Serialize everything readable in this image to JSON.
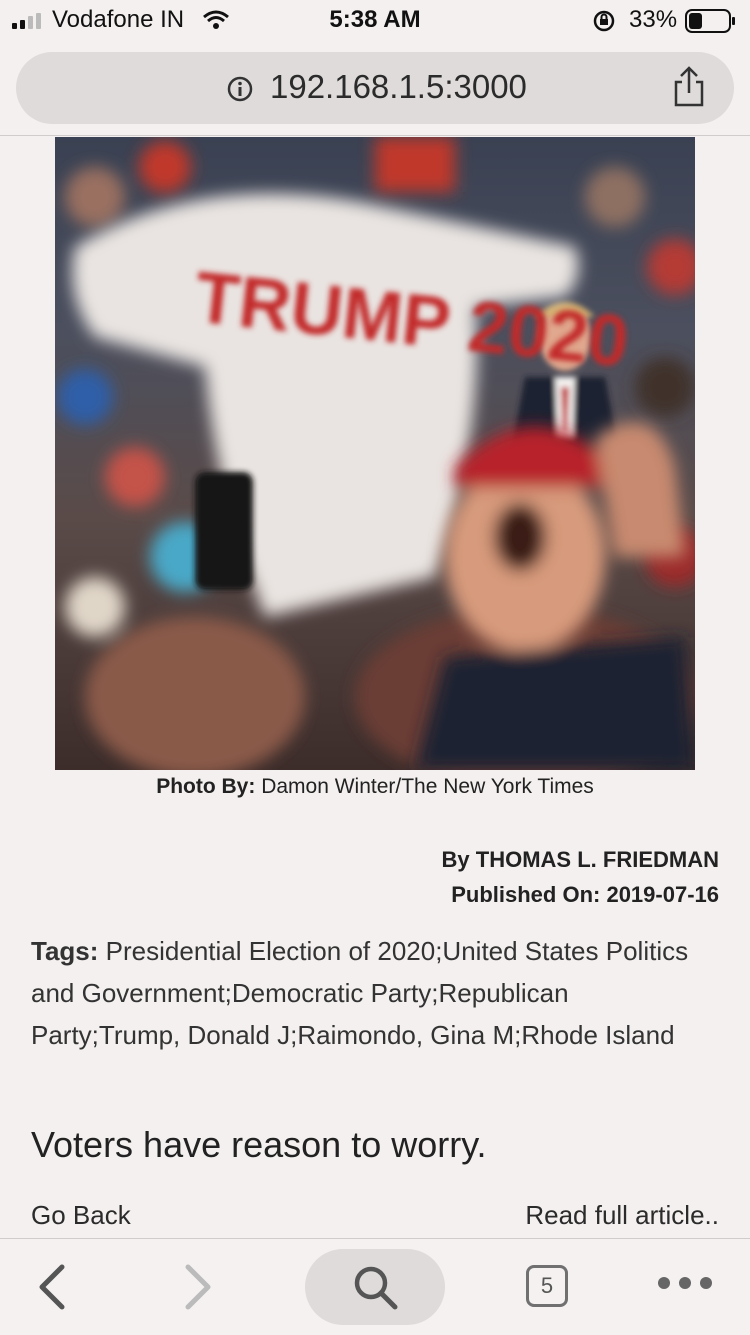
{
  "status_bar": {
    "carrier": "Vodafone IN",
    "time": "5:38 AM",
    "battery_percent": "33%",
    "battery_level": 0.33
  },
  "browser": {
    "url": "192.168.1.5:3000",
    "tab_count": "5"
  },
  "article": {
    "photo_overlay_text": "TRUMP 2020",
    "caption_label": "Photo By:",
    "caption_value": "Damon Winter/The New York Times",
    "byline": "By THOMAS L. FRIEDMAN",
    "published": "Published On: 2019-07-16",
    "tags_label": "Tags:",
    "tags_value": "Presidential Election of 2020;United States Politics and Government;Democratic Party;Republican Party;Trump, Donald J;Raimondo, Gina M;Rhode Island",
    "teaser": "Voters have reason to worry.",
    "go_back": "Go Back",
    "read_full": "Read full article.."
  },
  "icons": [
    "signal-icon",
    "wifi-icon",
    "orientation-lock-icon",
    "battery-icon",
    "info-icon",
    "share-icon",
    "back-arrow-icon",
    "forward-arrow-icon",
    "search-icon",
    "tabs-icon",
    "more-icon"
  ]
}
